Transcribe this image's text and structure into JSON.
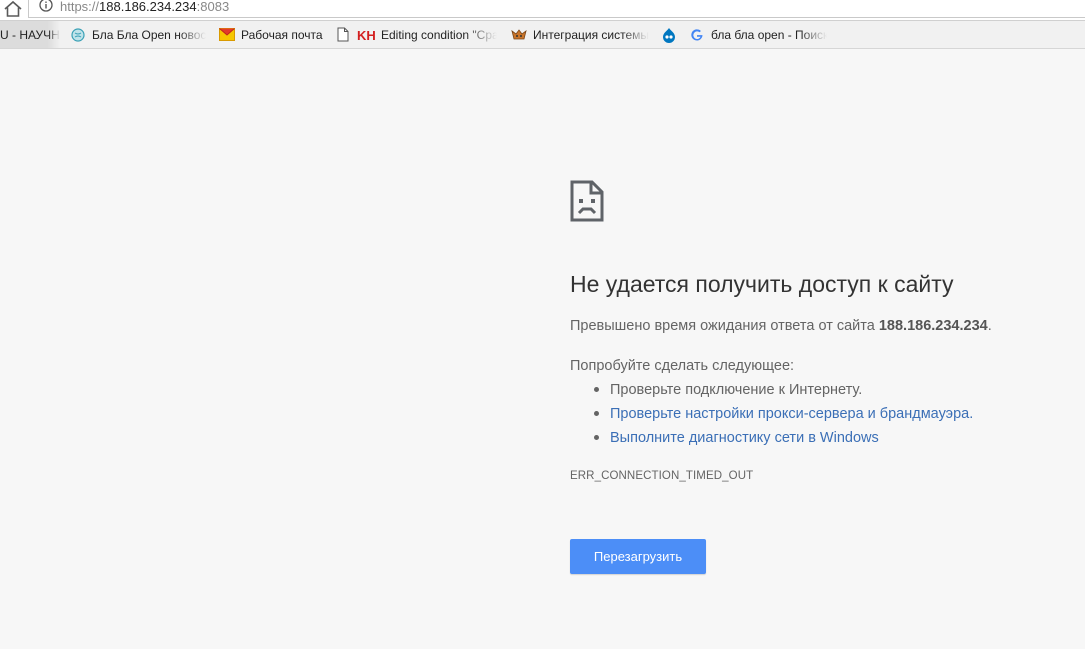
{
  "address_bar": {
    "scheme": "https://",
    "host": "188.186.234.234",
    "port": ":8083"
  },
  "bookmarks": [
    {
      "label": "U - НАУЧН",
      "icon": "none"
    },
    {
      "label": "Бла Бла Open новост",
      "icon": "globe-icon"
    },
    {
      "label": "Рабочая почта",
      "icon": "mail-envelope-icon"
    },
    {
      "label": "Editing condition \"Сра",
      "icon": "page-icon"
    },
    {
      "label": "Интеграция системы",
      "icon": "fox-icon"
    },
    {
      "label": "",
      "icon": "drupal-icon"
    },
    {
      "label": "бла бла open - Поиск",
      "icon": "google-icon"
    }
  ],
  "error": {
    "title": "Не удается получить доступ к сайту",
    "subtitle_prefix": "Превышено время ожидания ответа от сайта ",
    "subtitle_host": "188.186.234.234",
    "subtitle_suffix": ".",
    "try_label": "Попробуйте сделать следующее:",
    "suggestions": [
      {
        "text": "Проверьте подключение к Интернету.",
        "link": false
      },
      {
        "text": "Проверьте настройки прокси-сервера и брандмауэра.",
        "link": true
      },
      {
        "text": "Выполните диагностику сети в Windows",
        "link": true
      }
    ],
    "code": "ERR_CONNECTION_TIMED_OUT",
    "reload_label": "Перезагрузить"
  },
  "colors": {
    "accent_button": "#4c8ef7",
    "link": "#3b6fb6",
    "background": "#f7f7f7"
  }
}
